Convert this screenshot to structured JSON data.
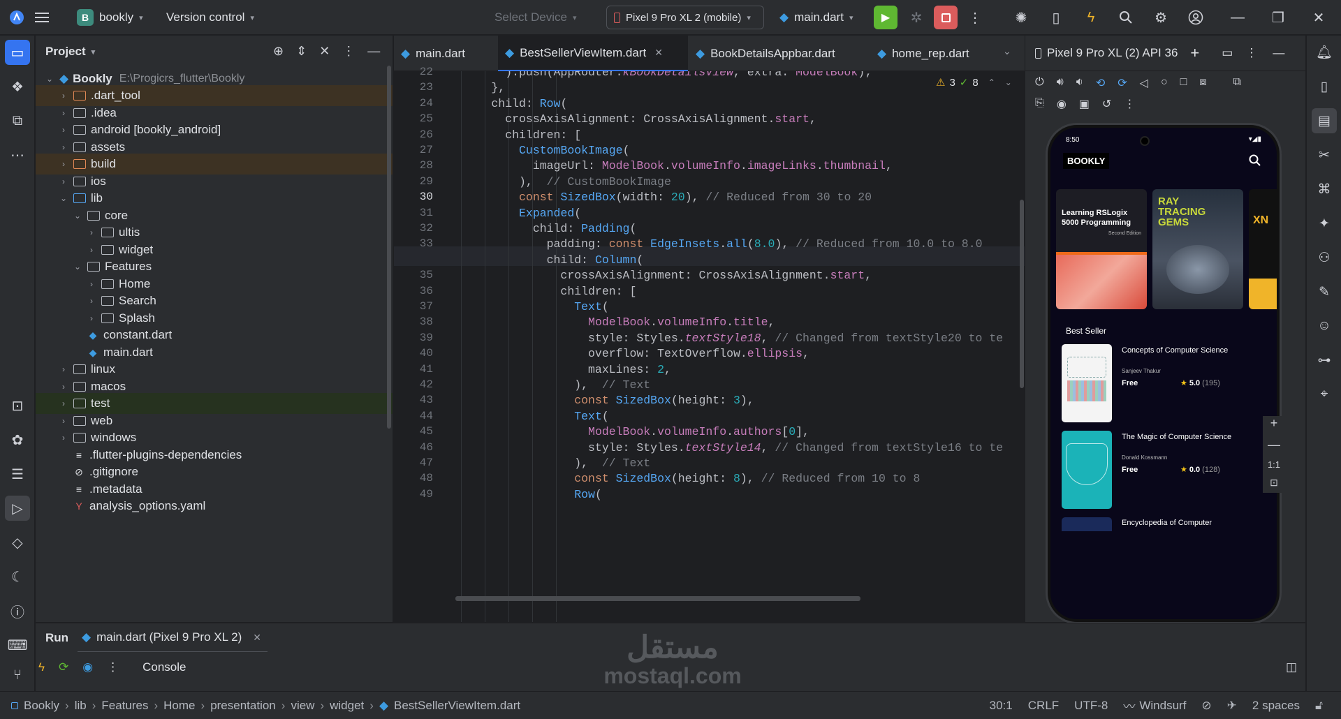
{
  "titlebar": {
    "project_badge": "B",
    "project_name": "bookly",
    "vcs_label": "Version control",
    "select_device": "Select Device",
    "device_selector": "Pixel 9 Pro XL 2 (mobile)",
    "run_config": "main.dart"
  },
  "project_panel": {
    "title": "Project",
    "root_name": "Bookly",
    "root_path": "E:\\Progicrs_flutter\\Bookly",
    "items": [
      {
        "label": ".dart_tool",
        "kind": "folder",
        "depth": 1,
        "arrow": "right",
        "highlight": "excluded"
      },
      {
        "label": ".idea",
        "kind": "folder",
        "depth": 1,
        "arrow": "right"
      },
      {
        "label": "android [bookly_android]",
        "kind": "folder",
        "depth": 1,
        "arrow": "right"
      },
      {
        "label": "assets",
        "kind": "folder",
        "depth": 1,
        "arrow": "right"
      },
      {
        "label": "build",
        "kind": "folder",
        "depth": 1,
        "arrow": "right",
        "highlight": "excluded"
      },
      {
        "label": "ios",
        "kind": "folder",
        "depth": 1,
        "arrow": "right"
      },
      {
        "label": "lib",
        "kind": "folder",
        "depth": 1,
        "arrow": "down"
      },
      {
        "label": "core",
        "kind": "folder",
        "depth": 2,
        "arrow": "down"
      },
      {
        "label": "ultis",
        "kind": "folder",
        "depth": 3,
        "arrow": "right"
      },
      {
        "label": "widget",
        "kind": "folder",
        "depth": 3,
        "arrow": "right"
      },
      {
        "label": "Features",
        "kind": "folder",
        "depth": 2,
        "arrow": "down"
      },
      {
        "label": "Home",
        "kind": "folder",
        "depth": 3,
        "arrow": "right"
      },
      {
        "label": "Search",
        "kind": "folder",
        "depth": 3,
        "arrow": "right"
      },
      {
        "label": "Splash",
        "kind": "folder",
        "depth": 3,
        "arrow": "right"
      },
      {
        "label": "constant.dart",
        "kind": "dart",
        "depth": 2,
        "arrow": ""
      },
      {
        "label": "main.dart",
        "kind": "dart",
        "depth": 2,
        "arrow": ""
      },
      {
        "label": "linux",
        "kind": "folder",
        "depth": 1,
        "arrow": "right"
      },
      {
        "label": "macos",
        "kind": "folder",
        "depth": 1,
        "arrow": "right"
      },
      {
        "label": "test",
        "kind": "folder",
        "depth": 1,
        "arrow": "right",
        "highlight": "test"
      },
      {
        "label": "web",
        "kind": "folder",
        "depth": 1,
        "arrow": "right"
      },
      {
        "label": "windows",
        "kind": "folder",
        "depth": 1,
        "arrow": "right"
      },
      {
        "label": ".flutter-plugins-dependencies",
        "kind": "text",
        "depth": 1,
        "arrow": ""
      },
      {
        "label": ".gitignore",
        "kind": "ignore",
        "depth": 1,
        "arrow": ""
      },
      {
        "label": ".metadata",
        "kind": "text",
        "depth": 1,
        "arrow": ""
      },
      {
        "label": "analysis_options.yaml",
        "kind": "yaml",
        "depth": 1,
        "arrow": ""
      }
    ]
  },
  "editor": {
    "tabs": [
      {
        "label": "main.dart",
        "active": false
      },
      {
        "label": "BestSellerViewItem.dart",
        "active": true
      },
      {
        "label": "BookDetailsAppbar.dart",
        "active": false
      },
      {
        "label": "home_rep.dart",
        "active": false
      }
    ],
    "warnings": "3",
    "checks": "8",
    "current_line": "30",
    "line_numbers": [
      "22",
      "23",
      "24",
      "25",
      "26",
      "27",
      "28",
      "29",
      "30",
      "31",
      "32",
      "33",
      "34",
      "35",
      "36",
      "37",
      "38",
      "39",
      "40",
      "41",
      "42",
      "43",
      "44",
      "45",
      "46",
      "47",
      "48",
      "49"
    ],
    "code_lines": [
      [
        [
          "        ).push(AppRouter.",
          ""
        ],
        [
          "kBookDetailsView",
          "fld it"
        ],
        [
          ", extra: ",
          ""
        ],
        [
          "ModelBook",
          "fld"
        ],
        [
          ");",
          ""
        ]
      ],
      [
        [
          "      },",
          ""
        ]
      ],
      [
        [
          "      child: ",
          ""
        ],
        [
          "Row",
          "cls"
        ],
        [
          "(",
          ""
        ]
      ],
      [
        [
          "        crossAxisAlignment: CrossAxisAlignment.",
          ""
        ],
        [
          "start",
          "fld"
        ],
        [
          ",",
          ""
        ]
      ],
      [
        [
          "        children: [",
          ""
        ]
      ],
      [
        [
          "          ",
          ""
        ],
        [
          "CustomBookImage",
          "cls"
        ],
        [
          "(",
          ""
        ]
      ],
      [
        [
          "            imageUrl: ",
          ""
        ],
        [
          "ModelBook",
          "fld"
        ],
        [
          ".",
          ""
        ],
        [
          "volumeInfo",
          "fld"
        ],
        [
          ".",
          ""
        ],
        [
          "imageLinks",
          "fld"
        ],
        [
          ".",
          ""
        ],
        [
          "thumbnail",
          "fld"
        ],
        [
          ",",
          ""
        ]
      ],
      [
        [
          "          ),  ",
          ""
        ],
        [
          "// CustomBookImage",
          "cm"
        ]
      ],
      [
        [
          "          ",
          ""
        ],
        [
          "const ",
          "kw"
        ],
        [
          "SizedBox",
          "cls"
        ],
        [
          "(width: ",
          ""
        ],
        [
          "20",
          "num"
        ],
        [
          "), ",
          ""
        ],
        [
          "// Reduced from 30 to 20",
          "cm"
        ]
      ],
      [
        [
          "          ",
          ""
        ],
        [
          "Expanded",
          "cls"
        ],
        [
          "(",
          ""
        ]
      ],
      [
        [
          "            child: ",
          ""
        ],
        [
          "Padding",
          "cls"
        ],
        [
          "(",
          ""
        ]
      ],
      [
        [
          "              padding: ",
          ""
        ],
        [
          "const ",
          "kw"
        ],
        [
          "EdgeInsets",
          "cls"
        ],
        [
          ".",
          ""
        ],
        [
          "all",
          "cls"
        ],
        [
          "(",
          ""
        ],
        [
          "8.0",
          "num"
        ],
        [
          "), ",
          ""
        ],
        [
          "// Reduced from 10.0 to 8.0",
          "cm"
        ]
      ],
      [
        [
          "              child: ",
          ""
        ],
        [
          "Column",
          "cls"
        ],
        [
          "(",
          ""
        ]
      ],
      [
        [
          "                crossAxisAlignment: CrossAxisAlignment.",
          ""
        ],
        [
          "start",
          "fld"
        ],
        [
          ",",
          ""
        ]
      ],
      [
        [
          "                children: [",
          ""
        ]
      ],
      [
        [
          "                  ",
          ""
        ],
        [
          "Text",
          "cls"
        ],
        [
          "(",
          ""
        ]
      ],
      [
        [
          "                    ",
          ""
        ],
        [
          "ModelBook",
          "fld"
        ],
        [
          ".",
          ""
        ],
        [
          "volumeInfo",
          "fld"
        ],
        [
          ".",
          ""
        ],
        [
          "title",
          "fld"
        ],
        [
          ",",
          ""
        ]
      ],
      [
        [
          "                    style: Styles.",
          ""
        ],
        [
          "textStyle18",
          "fld it"
        ],
        [
          ", ",
          ""
        ],
        [
          "// Changed from textStyle20 to te",
          "cm"
        ]
      ],
      [
        [
          "                    overflow: TextOverflow.",
          ""
        ],
        [
          "ellipsis",
          "fld"
        ],
        [
          ",",
          ""
        ]
      ],
      [
        [
          "                    maxLines: ",
          ""
        ],
        [
          "2",
          "num"
        ],
        [
          ",",
          ""
        ]
      ],
      [
        [
          "                  ),  ",
          ""
        ],
        [
          "// Text",
          "cm"
        ]
      ],
      [
        [
          "                  ",
          ""
        ],
        [
          "const ",
          "kw"
        ],
        [
          "SizedBox",
          "cls"
        ],
        [
          "(height: ",
          ""
        ],
        [
          "3",
          "num"
        ],
        [
          "),",
          ""
        ]
      ],
      [
        [
          "                  ",
          ""
        ],
        [
          "Text",
          "cls"
        ],
        [
          "(",
          ""
        ]
      ],
      [
        [
          "                    ",
          ""
        ],
        [
          "ModelBook",
          "fld"
        ],
        [
          ".",
          ""
        ],
        [
          "volumeInfo",
          "fld"
        ],
        [
          ".",
          ""
        ],
        [
          "authors",
          "fld"
        ],
        [
          "[",
          ""
        ],
        [
          "0",
          "num"
        ],
        [
          "],",
          ""
        ]
      ],
      [
        [
          "                    style: Styles.",
          ""
        ],
        [
          "textStyle14",
          "fld it"
        ],
        [
          ", ",
          ""
        ],
        [
          "// Changed from textStyle16 to te",
          "cm"
        ]
      ],
      [
        [
          "                  ),  ",
          ""
        ],
        [
          "// Text",
          "cm"
        ]
      ],
      [
        [
          "                  ",
          ""
        ],
        [
          "const ",
          "kw"
        ],
        [
          "SizedBox",
          "cls"
        ],
        [
          "(height: ",
          ""
        ],
        [
          "8",
          "num"
        ],
        [
          "), ",
          ""
        ],
        [
          "// Reduced from 10 to 8",
          "cm"
        ]
      ],
      [
        [
          "                  ",
          ""
        ],
        [
          "Row",
          "cls"
        ],
        [
          "(",
          ""
        ]
      ]
    ]
  },
  "device_panel": {
    "title": "Pixel 9 Pro XL (2) API 36",
    "zoom_label": "1:1",
    "app": {
      "status_time": "8:50",
      "app_title": "BOOKLY",
      "section_title": "Best Seller",
      "carousel": [
        {
          "title": "Learning RSLogix 5000 Programming",
          "subtitle": "Second Edition"
        },
        {
          "title": "RAY TRACING GEMS"
        },
        {
          "title": "XN"
        }
      ],
      "books": [
        {
          "title": "Concepts of Computer Science",
          "author": "Sanjeev Thakur",
          "price": "Free",
          "rating": "5.0",
          "count": "(195)"
        },
        {
          "title": "The Magic of Computer Science",
          "author": "Donald Kossmann",
          "price": "Free",
          "rating": "0.0",
          "count": "(128)"
        },
        {
          "title": "Encyclopedia of Computer",
          "author": "",
          "price": "",
          "rating": "",
          "count": ""
        }
      ]
    }
  },
  "bottom": {
    "run_tab": "Run",
    "run_config_tab": "main.dart (Pixel 9 Pro XL 2)",
    "console_label": "Console"
  },
  "statusbar": {
    "breadcrumbs": [
      "Bookly",
      "lib",
      "Features",
      "Home",
      "presentation",
      "view",
      "widget",
      "BestSellerViewItem.dart"
    ],
    "position": "30:1",
    "line_sep": "CRLF",
    "encoding": "UTF-8",
    "plugin": "Windsurf",
    "indent": "2 spaces"
  },
  "watermark": {
    "arabic": "مستقل",
    "latin": "mostaql.com"
  },
  "colors": {
    "accent": "#3574f0",
    "run": "#5fb832",
    "stop": "#db5c5c",
    "star": "#f5c518"
  }
}
